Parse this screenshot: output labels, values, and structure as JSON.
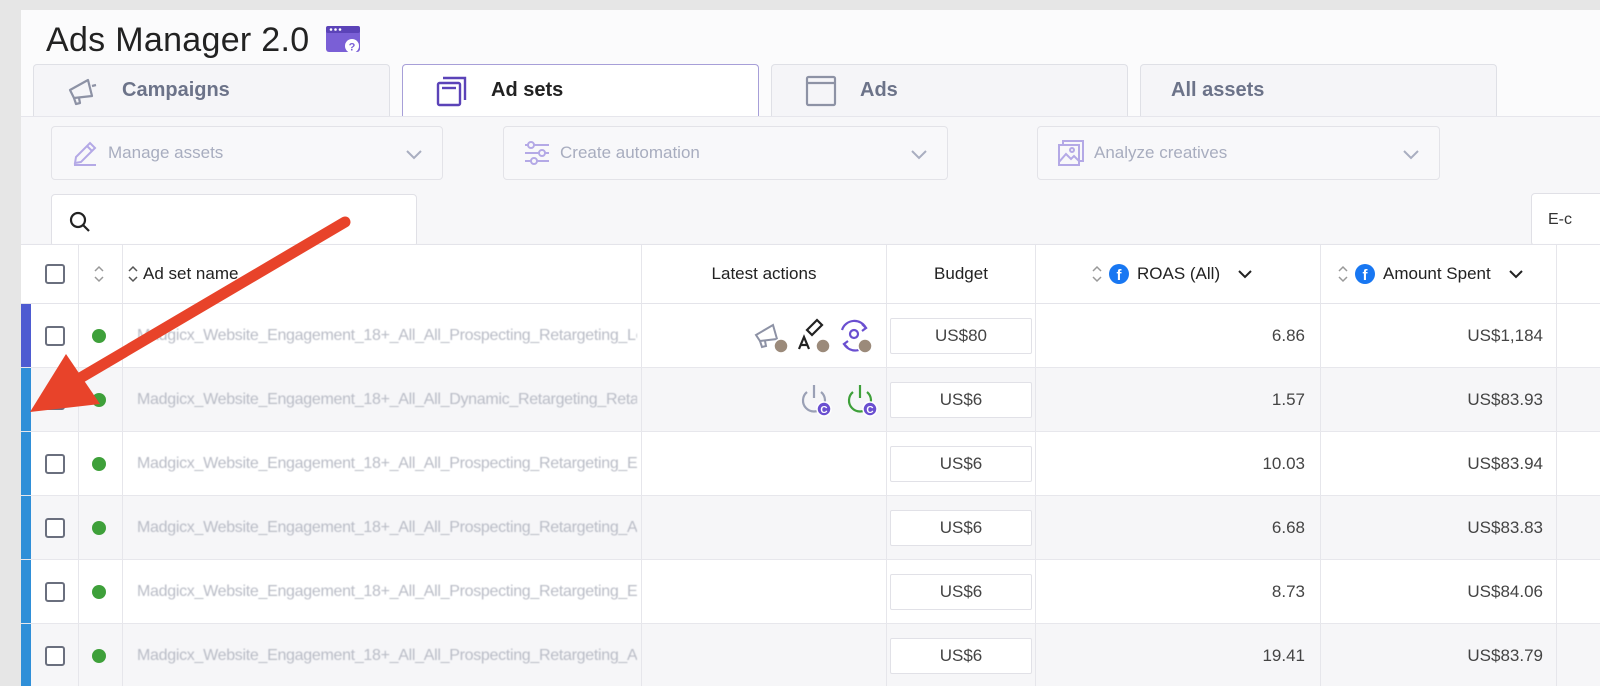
{
  "app": {
    "title": "Ads Manager 2.0"
  },
  "tabs": [
    {
      "label": "Campaigns",
      "icon": "megaphone-icon",
      "active": false
    },
    {
      "label": "Ad sets",
      "icon": "stacked-squares-icon",
      "active": true
    },
    {
      "label": "Ads",
      "icon": "square-icon",
      "active": false
    },
    {
      "label": "All assets",
      "icon": "",
      "active": false
    }
  ],
  "toolbar": {
    "manage_assets": "Manage assets",
    "create_automation": "Create automation",
    "analyze_creatives": "Analyze creatives",
    "search_placeholder": "",
    "filter_pill": "E-c"
  },
  "table": {
    "headers": {
      "name": "Ad set name",
      "latest_actions": "Latest actions",
      "budget": "Budget",
      "roas": "ROAS (All)",
      "amount_spent": "Amount Spent"
    },
    "rows": [
      {
        "name": "Madgicx_Website_Engagement_18+_All_All_Prospecting_Retargeting_Lookalike_P...",
        "status": "active",
        "budget": "US$80",
        "roas": "6.86",
        "spent": "US$1,184",
        "stripe": "#4e5bd1",
        "actions": [
          "megaphone-edit-icon",
          "text-edit-icon",
          "refresh-user-icon"
        ]
      },
      {
        "name": "Madgicx_Website_Engagement_18+_All_All_Dynamic_Retargeting_Retargeti...",
        "status": "active",
        "budget": "US$6",
        "roas": "1.57",
        "spent": "US$83.93",
        "stripe": "#2f8fd8",
        "actions": [
          "power-off-icon",
          "power-on-icon"
        ]
      },
      {
        "name": "Madgicx_Website_Engagement_18+_All_All_Prospecting_Retargeting_Engaged...",
        "status": "active",
        "budget": "US$6",
        "roas": "10.03",
        "spent": "US$83.94",
        "stripe": "#2f8fd8",
        "actions": []
      },
      {
        "name": "Madgicx_Website_Engagement_18+_All_All_Prospecting_Retargeting_Al...",
        "status": "active",
        "budget": "US$6",
        "roas": "6.68",
        "spent": "US$83.83",
        "stripe": "#2f8fd8",
        "actions": []
      },
      {
        "name": "Madgicx_Website_Engagement_18+_All_All_Prospecting_Retargeting_Engaged_...",
        "status": "active",
        "budget": "US$6",
        "roas": "8.73",
        "spent": "US$84.06",
        "stripe": "#2f8fd8",
        "actions": []
      },
      {
        "name": "Madgicx_Website_Engagement_18+_All_All_Prospecting_Retargeting_Al...",
        "status": "active",
        "budget": "US$6",
        "roas": "19.41",
        "spent": "US$83.79",
        "stripe": "#2f8fd8",
        "actions": []
      }
    ]
  },
  "colors": {
    "accent": "#7a5fd6",
    "status_active": "#3ea03a",
    "annotation_arrow": "#e8432a",
    "facebook": "#1877f2"
  }
}
